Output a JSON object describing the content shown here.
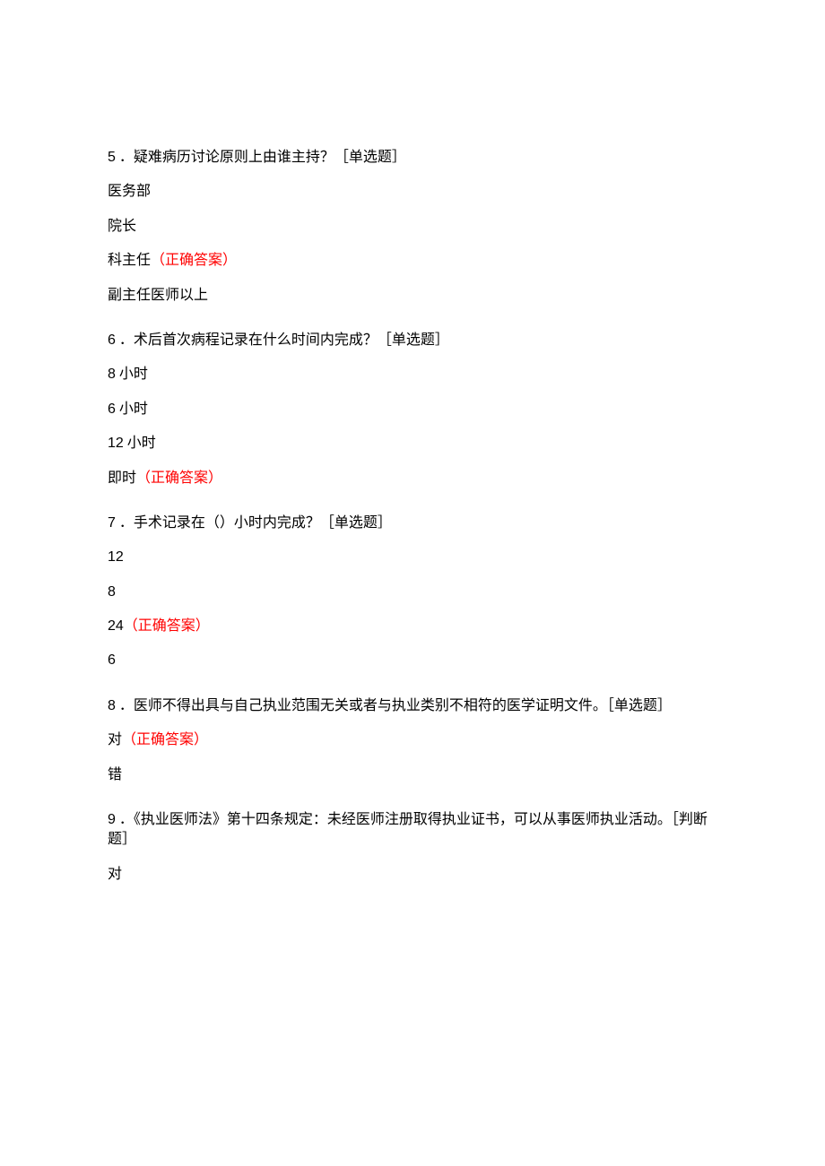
{
  "correct_label": "（正确答案）",
  "questions": [
    {
      "num": "5",
      "text": "．疑难病历讨论原则上由谁主持？［单选题］",
      "options": [
        {
          "text": "医务部",
          "correct": false
        },
        {
          "text": "院长",
          "correct": false
        },
        {
          "text": "科主任",
          "correct": true
        },
        {
          "text": "副主任医师以上",
          "correct": false
        }
      ]
    },
    {
      "num": "6",
      "text": "．术后首次病程记录在什么时间内完成？［单选题］",
      "options": [
        {
          "text_num": "8",
          "text_suffix": " 小时",
          "correct": false
        },
        {
          "text_num": "6",
          "text_suffix": " 小时",
          "correct": false
        },
        {
          "text_num": "12",
          "text_suffix": " 小时",
          "correct": false
        },
        {
          "text": "即时",
          "correct": true
        }
      ]
    },
    {
      "num": "7",
      "text": "．手术记录在（）小时内完成？［单选题］",
      "options": [
        {
          "text_num": "12",
          "correct": false
        },
        {
          "text_num": "8",
          "correct": false
        },
        {
          "text_num": "24",
          "correct": true
        },
        {
          "text_num": "6",
          "correct": false
        }
      ]
    },
    {
      "num": "8",
      "text": "．医师不得出具与自己执业范围无关或者与执业类别不相符的医学证明文件。［单选题］",
      "options": [
        {
          "text": "对",
          "correct": true
        },
        {
          "text": "错",
          "correct": false
        }
      ]
    },
    {
      "num": "9",
      "text": "．《执业医师法》第十四条规定：未经医师注册取得执业证书，可以从事医师执业活动。［判断题］",
      "options": [
        {
          "text": "对",
          "correct": false
        }
      ]
    }
  ]
}
